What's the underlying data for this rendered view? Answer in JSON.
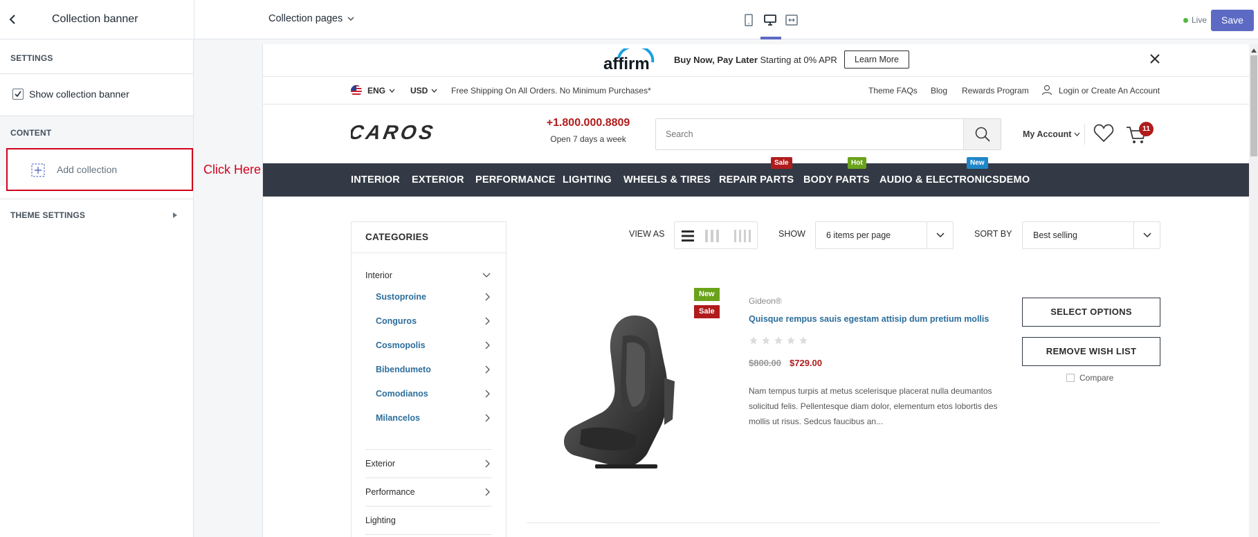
{
  "topbar": {
    "back_label": "Collection banner",
    "page_selector": "Collection pages",
    "live_label": "Live",
    "save_label": "Save"
  },
  "sidebar": {
    "settings_heading": "SETTINGS",
    "show_banner_label": "Show collection banner",
    "show_banner_checked": true,
    "content_heading": "CONTENT",
    "add_collection_label": "Add collection",
    "theme_settings_label": "THEME SETTINGS"
  },
  "annotation": {
    "click_here": "Click Here",
    "color": "#d0021b"
  },
  "preview": {
    "promo": {
      "logo_text": "affirm",
      "bold_text": "Buy Now, Pay Later",
      "text": "Starting at 0% APR",
      "button": "Learn More"
    },
    "utility": {
      "language": "ENG",
      "currency": "USD",
      "shipping": "Free Shipping On All Orders. No Minimum Purchases*",
      "links": [
        "Theme FAQs",
        "Blog",
        "Rewards Program"
      ],
      "account_link": "Login or Create An Account"
    },
    "header": {
      "logo": "CAROS",
      "phone": "+1.800.000.8809",
      "hours": "Open 7 days a week",
      "search_placeholder": "Search",
      "my_account": "My Account",
      "cart_count": "11"
    },
    "nav": {
      "items": [
        "INTERIOR",
        "EXTERIOR",
        "PERFORMANCE",
        "LIGHTING",
        "WHEELS & TIRES",
        "REPAIR PARTS",
        "BODY PARTS",
        "AUDIO & ELECTRONICS",
        "DEMO"
      ],
      "badges": {
        "sale": "Sale",
        "hot": "Hot",
        "new": "New"
      }
    },
    "categories": {
      "title": "CATEGORIES",
      "open_item": "Interior",
      "sub_items": [
        "Sustoproine",
        "Conguros",
        "Cosmopolis",
        "Bibendumeto",
        "Comodianos",
        "Milancelos"
      ],
      "other_items": [
        "Exterior",
        "Performance",
        "Lighting"
      ]
    },
    "toolbar": {
      "view_as": "VIEW AS",
      "show": "SHOW",
      "show_value": "6 items per page",
      "sort_by": "SORT BY",
      "sort_value": "Best selling"
    },
    "product": {
      "label_new": "New",
      "label_sale": "Sale",
      "vendor": "Gideon®",
      "title": "Quisque rempus sauis egestam attisip dum pretium mollis",
      "old_price": "$800.00",
      "price": "$729.00",
      "description": "Nam tempus turpis at metus scelerisque placerat nulla deumantos solicitud felis. Pellentesque diam dolor, elementum etos lobortis des mollis ut risus. Sedcus faucibus an...",
      "select_options": "SELECT OPTIONS",
      "remove_wishlist": "REMOVE WISH LIST",
      "compare": "Compare",
      "rating": 0
    },
    "colors": {
      "nav_bg": "#343a45",
      "sale": "#b01c1c",
      "hot": "#6aa31a",
      "new": "#1f87c8",
      "link": "#2d6e9b",
      "price": "#b01c1c",
      "save_button": "#5c6ac4"
    }
  }
}
